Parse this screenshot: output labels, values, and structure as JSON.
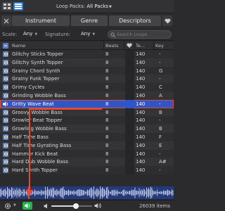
{
  "topbar": {
    "view_grid_icon": "grid-view-icon",
    "view_list_icon": "list-view-icon",
    "loop_packs_label": "Loop Packs:",
    "loop_packs_value": "All Packs"
  },
  "tabs": {
    "reset_icon": "reset-x-icon",
    "instrument": "Instrument",
    "genre": "Genre",
    "descriptors": "Descriptors",
    "favorites_icon": "heart-icon"
  },
  "filters": {
    "scale_label": "Scale:",
    "scale_value": "Any",
    "signature_label": "Signature:",
    "signature_value": "Any",
    "search_placeholder": "Search Loops",
    "search_value": ""
  },
  "table": {
    "columns": {
      "name": "Name",
      "beats": "Beats",
      "tempo": "Te...",
      "key": "Key"
    },
    "rows": [
      {
        "name": "Glitchy Sticks Topper",
        "beats": "8",
        "tempo": "140",
        "key": "-"
      },
      {
        "name": "Glitchy Synth Topper",
        "beats": "8",
        "tempo": "140",
        "key": "-"
      },
      {
        "name": "Grainy Chord Synth",
        "beats": "8",
        "tempo": "140",
        "key": "G"
      },
      {
        "name": "Grainy Funk Topper",
        "beats": "8",
        "tempo": "140",
        "key": "-"
      },
      {
        "name": "Grimy Cycles",
        "beats": "8",
        "tempo": "140",
        "key": "C"
      },
      {
        "name": "Grinding Wobble Bass",
        "beats": "8",
        "tempo": "140",
        "key": "A"
      },
      {
        "name": "Gritty Wave Beat",
        "beats": "8",
        "tempo": "140",
        "key": "-",
        "selected": true
      },
      {
        "name": "Groovy Wobble Bass",
        "beats": "8",
        "tempo": "140",
        "key": "B"
      },
      {
        "name": "Growler Beat Topper",
        "beats": "8",
        "tempo": "140",
        "key": "-"
      },
      {
        "name": "Growling Wobble Bass",
        "beats": "8",
        "tempo": "140",
        "key": "B"
      },
      {
        "name": "Half Time Bass",
        "beats": "8",
        "tempo": "140",
        "key": "F"
      },
      {
        "name": "Half Time Gyrating Bass",
        "beats": "8",
        "tempo": "140",
        "key": "E"
      },
      {
        "name": "Hammer Kick Beat",
        "beats": "8",
        "tempo": "140",
        "key": "-"
      },
      {
        "name": "Hard Dub Wobble Bass",
        "beats": "8",
        "tempo": "140",
        "key": "A#"
      },
      {
        "name": "Hard Synth Topper",
        "beats": "8",
        "tempo": "140",
        "key": "-"
      }
    ]
  },
  "bottombar": {
    "settings_icon": "gear-icon",
    "speaker_icon": "speaker-icon",
    "volume_level": 0.6,
    "items_count": "26039 items"
  },
  "colors": {
    "selected_row": "#2d57c9",
    "annotation_red": "#e84a2f",
    "speaker_green": "#26b34b",
    "waveform": "#243a7a"
  }
}
